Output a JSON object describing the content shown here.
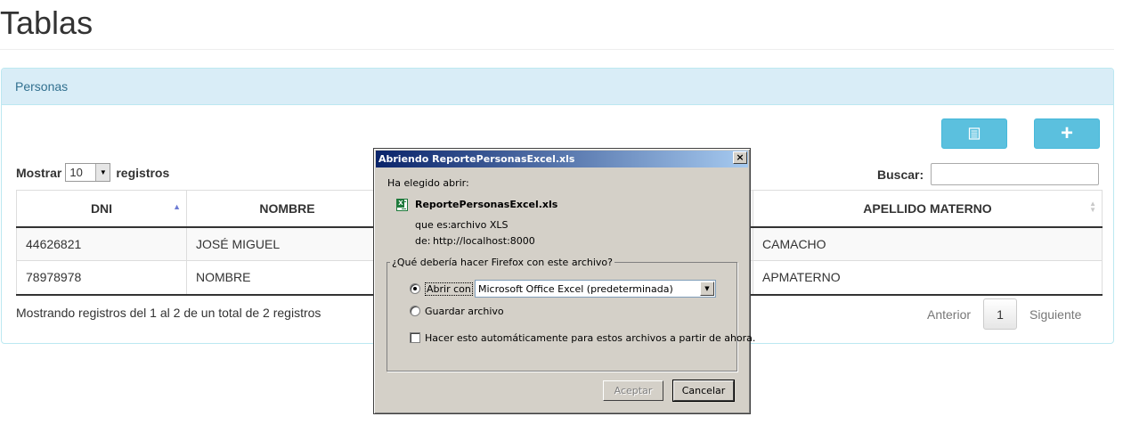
{
  "page": {
    "title": "Tablas"
  },
  "panel": {
    "heading": "Personas",
    "toolbar": {
      "export_icon": "spreadsheet-list-icon",
      "add_label": "+"
    },
    "length": {
      "prefix": "Mostrar",
      "value": "10",
      "suffix": "registros"
    },
    "search": {
      "label": "Buscar:",
      "value": ""
    },
    "table": {
      "columns": [
        "DNI",
        "NOMBRE",
        "APELLIDO MATERNO"
      ],
      "rows": [
        {
          "dni": "44626821",
          "nombre": "JOSÉ MIGUEL",
          "apellido_materno": "CAMACHO"
        },
        {
          "dni": "78978978",
          "nombre": "NOMBRE",
          "apellido_materno": "APMATERNO"
        }
      ]
    },
    "info": "Mostrando registros del 1 al 2 de un total de 2 registros",
    "pagination": {
      "previous": "Anterior",
      "current_page": "1",
      "next": "Siguiente"
    }
  },
  "dialog": {
    "title": "Abriendo ReportePersonasExcel.xls",
    "close_label": "×",
    "intro": "Ha elegido abrir:",
    "file_name": "ReportePersonasExcel.xls",
    "type_label": "que es:",
    "type_value": "archivo XLS",
    "from_label": "de:",
    "from_value": "http://localhost:8000",
    "question": "¿Qué debería hacer Firefox con este archivo?",
    "open_with_label": "Abrir con",
    "open_with_selected": true,
    "application": "Microsoft Office Excel (predeterminada)",
    "save_label": "Guardar archivo",
    "auto_label": "Hacer esto automáticamente para estos archivos a partir de ahora.",
    "auto_checked": false,
    "ok_label": "Aceptar",
    "cancel_label": "Cancelar"
  }
}
